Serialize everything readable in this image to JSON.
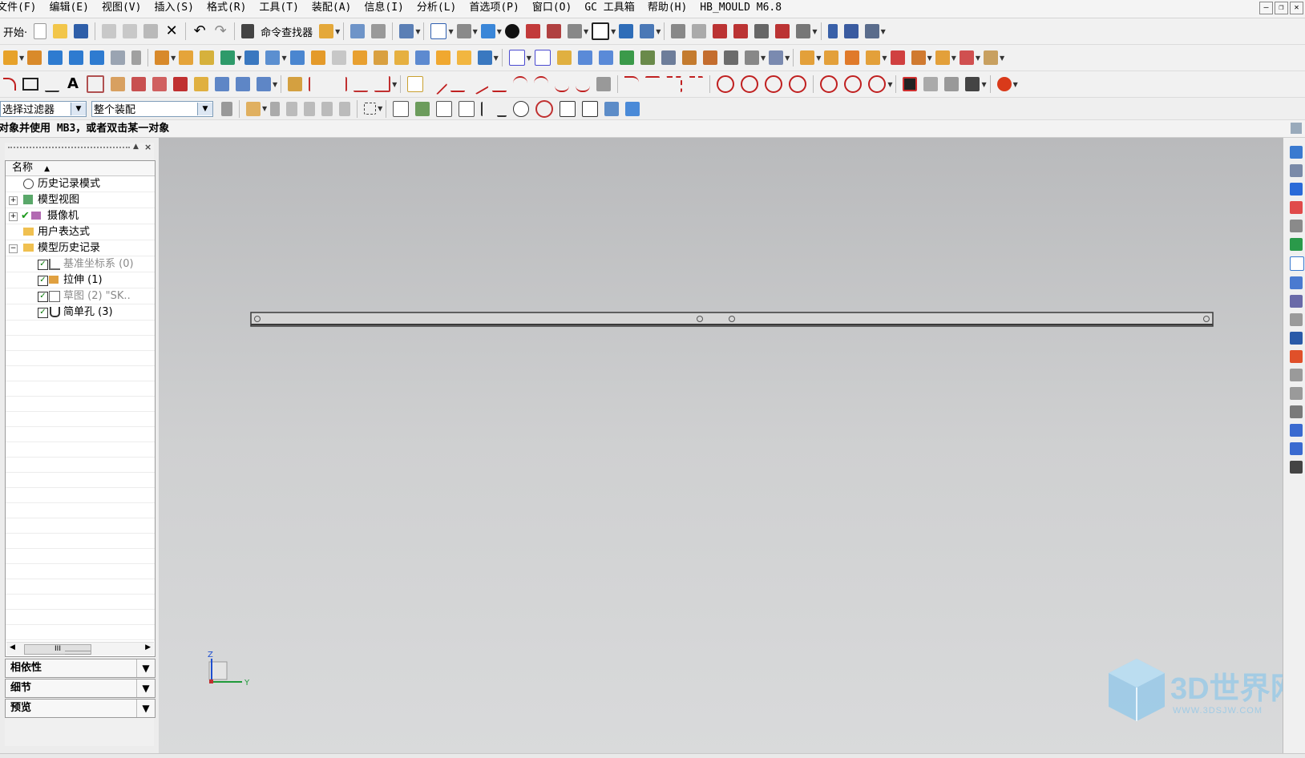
{
  "menu": [
    "文件(F)",
    "编辑(E)",
    "视图(V)",
    "插入(S)",
    "格式(R)",
    "工具(T)",
    "装配(A)",
    "信息(I)",
    "分析(L)",
    "首选项(P)",
    "窗口(O)",
    "GC 工具箱",
    "帮助(H)",
    "HB_MOULD M6.8"
  ],
  "toolbar": {
    "start_label": "开始·",
    "command_finder_label": "命令查找器"
  },
  "selection_bar": {
    "filter_value": "选择过滤器",
    "scope_value": "整个装配"
  },
  "status": {
    "prompt": "对象并使用 MB3，或者双击某一对象"
  },
  "navigator": {
    "column_header": "名称",
    "sort_indicator": "▲",
    "items": [
      {
        "label": "历史记录模式"
      },
      {
        "label": "模型视图"
      },
      {
        "label": "摄像机"
      },
      {
        "label": "用户表达式"
      },
      {
        "label": "模型历史记录"
      },
      {
        "label": "基准坐标系 (0)"
      },
      {
        "label": "拉伸 (1)"
      },
      {
        "label": "草图 (2) \"SK.."
      },
      {
        "label": "简单孔 (3)"
      }
    ],
    "panels": [
      "相依性",
      "细节",
      "预览"
    ],
    "scroll_grip": "III"
  },
  "triad": {
    "z": "Z",
    "y": "Y"
  },
  "watermark": {
    "title": "3D世界网",
    "url": "WWW.3DSJW.COM"
  },
  "colors": {
    "part_fill": "#d6d6d6",
    "part_edge": "#3a3a3a",
    "watermark": "#8fc7e9"
  }
}
